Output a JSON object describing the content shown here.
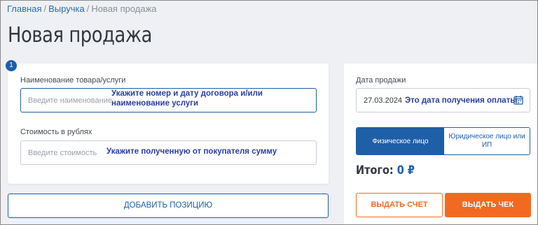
{
  "colors": {
    "primary": "#1e5fa7",
    "accent": "#f26a21",
    "hint_text": "#2b3f9e",
    "background": "#eef0f3"
  },
  "breadcrumb": {
    "items": [
      "Главная",
      "Выручка",
      "Новая продажа"
    ],
    "separator": "/"
  },
  "page_title": "Новая продажа",
  "step": {
    "number": "1"
  },
  "item_form": {
    "name_label": "Наименование товара/услуги",
    "name_placeholder": "Введите наименование",
    "name_hint": "Укажите номер и дату договора и/или наименование услуги",
    "price_label": "Стоимость в рублях",
    "price_placeholder": "Введите стоимость",
    "price_hint": "Укажите полученную от покупателя сумму"
  },
  "add_position_button": "ДОБАВИТЬ ПОЗИЦИЮ",
  "sale": {
    "date_label": "Дата продажи",
    "date_value": "27.03.2024",
    "date_hint": "Это дата получения оплаты",
    "calendar_icon": "calendar-icon"
  },
  "customer_type": {
    "options": [
      "Физическое лицо",
      "Юридическое лицо или ИП"
    ],
    "selected": "Физическое лицо"
  },
  "total": {
    "label": "Итого:",
    "value": "0 ₽"
  },
  "actions": {
    "invoice_label": "ВЫДАТЬ СЧЕТ",
    "receipt_label": "ВЫДАТЬ ЧЕК"
  }
}
